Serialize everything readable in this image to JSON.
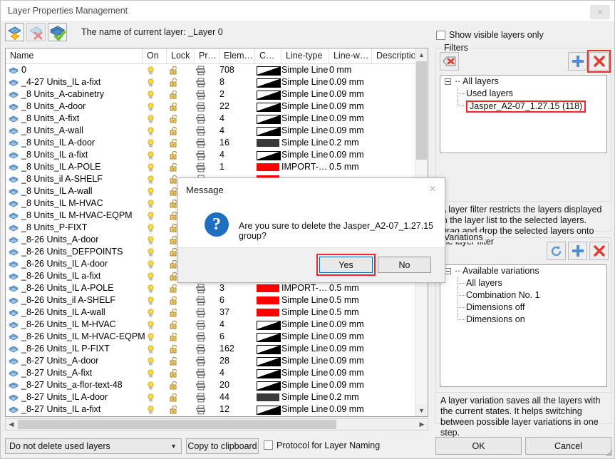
{
  "window": {
    "title": "Layer Properties Management",
    "close_icon": "close-icon"
  },
  "toolbar": {
    "buttons": [
      {
        "name": "new-layer-icon",
        "title": "New layer"
      },
      {
        "name": "delete-layer-icon",
        "title": "Delete layer"
      },
      {
        "name": "set-current-layer-icon",
        "title": "Set current layer"
      }
    ],
    "current_layer_text": "The name of current layer:  _Layer 0"
  },
  "layer_table": {
    "columns": [
      "Name",
      "On",
      "Lock",
      "Pr…",
      "Elem…",
      "C…",
      "Line-type",
      "Line-w…",
      "Description"
    ],
    "rows": [
      {
        "name": "0",
        "elem": "708",
        "color": "gradient",
        "linetype": "Simple Line",
        "linew": "0 mm"
      },
      {
        "name": "_4-27 Units_IL a-fixt",
        "elem": "8",
        "color": "gradient",
        "linetype": "Simple Line",
        "linew": "0.09 mm"
      },
      {
        "name": "_8 Units_A-cabinetry",
        "elem": "2",
        "color": "gradient",
        "linetype": "Simple Line",
        "linew": "0.09 mm"
      },
      {
        "name": "_8 Units_A-door",
        "elem": "22",
        "color": "gradient",
        "linetype": "Simple Line",
        "linew": "0.09 mm"
      },
      {
        "name": "_8 Units_A-fixt",
        "elem": "4",
        "color": "gradient",
        "linetype": "Simple Line",
        "linew": "0.09 mm"
      },
      {
        "name": "_8 Units_A-wall",
        "elem": "4",
        "color": "gradient",
        "linetype": "Simple Line",
        "linew": "0.09 mm"
      },
      {
        "name": "_8 Units_IL A-door",
        "elem": "16",
        "color": "dark",
        "linetype": "Simple Line",
        "linew": "0.2 mm"
      },
      {
        "name": "_8 Units_IL a-fixt",
        "elem": "4",
        "color": "gradient",
        "linetype": "Simple Line",
        "linew": "0.09 mm"
      },
      {
        "name": "_8 Units_IL A-POLE",
        "elem": "1",
        "color": "red",
        "linetype": "IMPORT-…",
        "linew": "0.5 mm"
      },
      {
        "name": "_8 Units_il A-SHELF",
        "elem": "",
        "color": "red",
        "linetype": "",
        "linew": ""
      },
      {
        "name": "_8 Units_IL A-wall",
        "elem": "",
        "color": "",
        "linetype": "",
        "linew": ""
      },
      {
        "name": "_8 Units_IL M-HVAC",
        "elem": "",
        "color": "",
        "linetype": "",
        "linew": ""
      },
      {
        "name": "_8 Units_IL M-HVAC-EQPM",
        "elem": "",
        "color": "",
        "linetype": "",
        "linew": ""
      },
      {
        "name": "_8 Units_P-FIXT",
        "elem": "",
        "color": "",
        "linetype": "",
        "linew": ""
      },
      {
        "name": "_8-26 Units_A-door",
        "elem": "",
        "color": "",
        "linetype": "",
        "linew": ""
      },
      {
        "name": "_8-26 Units_DEFPOINTS",
        "elem": "",
        "color": "",
        "linetype": "",
        "linew": ""
      },
      {
        "name": "_8-26 Units_IL A-door",
        "elem": "",
        "color": "",
        "linetype": "",
        "linew": ""
      },
      {
        "name": "_8-26 Units_IL a-fixt",
        "elem": "",
        "color": "",
        "linetype": "",
        "linew": ""
      },
      {
        "name": "_8-26 Units_IL A-POLE",
        "elem": "3",
        "color": "red",
        "linetype": "IMPORT-…",
        "linew": "0.5 mm"
      },
      {
        "name": "_8-26 Units_il A-SHELF",
        "elem": "6",
        "color": "red",
        "linetype": "Simple Line",
        "linew": "0.5 mm"
      },
      {
        "name": "_8-26 Units_IL A-wall",
        "elem": "37",
        "color": "red",
        "linetype": "Simple Line",
        "linew": "0.5 mm"
      },
      {
        "name": "_8-26 Units_IL M-HVAC",
        "elem": "4",
        "color": "gradient",
        "linetype": "Simple Line",
        "linew": "0.09 mm"
      },
      {
        "name": "_8-26 Units_IL M-HVAC-EQPM",
        "elem": "6",
        "color": "gradient",
        "linetype": "Simple Line",
        "linew": "0.09 mm"
      },
      {
        "name": "_8-26 Units_IL P-FIXT",
        "elem": "162",
        "color": "gradient",
        "linetype": "Simple Line",
        "linew": "0.09 mm"
      },
      {
        "name": "_8-27 Units_A-door",
        "elem": "28",
        "color": "gradient",
        "linetype": "Simple Line",
        "linew": "0.09 mm"
      },
      {
        "name": "_8-27 Units_A-fixt",
        "elem": "4",
        "color": "gradient",
        "linetype": "Simple Line",
        "linew": "0.09 mm"
      },
      {
        "name": "_8-27 Units_a-flor-text-48",
        "elem": "20",
        "color": "gradient",
        "linetype": "Simple Line",
        "linew": "0.09 mm"
      },
      {
        "name": "_8-27 Units_IL A-door",
        "elem": "44",
        "color": "dark",
        "linetype": "Simple Line",
        "linew": "0.2 mm"
      },
      {
        "name": "_8-27 Units_IL a-fixt",
        "elem": "12",
        "color": "gradient",
        "linetype": "Simple Line",
        "linew": "0.09 mm"
      }
    ]
  },
  "bottom_bar": {
    "delete_mode": "Do not delete used layers",
    "copy_button": "Copy to clipboard",
    "protocol_checkbox_label": "Protocol for Layer Naming",
    "protocol_checked": false
  },
  "right_panel": {
    "show_visible_only_label": "Show visible layers only",
    "show_visible_only_checked": false,
    "filters": {
      "legend": "Filters",
      "buttons": [
        {
          "name": "invert-filter-icon"
        },
        {
          "name": "add-filter-icon"
        },
        {
          "name": "delete-filter-icon",
          "highlighted": true
        }
      ],
      "tree": [
        {
          "label": "All layers",
          "level": 0,
          "expander": true
        },
        {
          "label": "Used layers",
          "level": 1
        },
        {
          "label": "Jasper_A2-07_1.27.15 (118)",
          "level": 1,
          "highlighted": true
        }
      ],
      "help": "A layer filter restricts the layers displayed in the layer list to the selected layers. Drag and drop the selected layers onto the layer filter"
    },
    "variations": {
      "legend": "Variations",
      "buttons": [
        {
          "name": "refresh-variation-icon"
        },
        {
          "name": "add-variation-icon"
        },
        {
          "name": "delete-variation-icon"
        }
      ],
      "tree": [
        {
          "label": "Available variations",
          "level": 0,
          "expander": true
        },
        {
          "label": "All layers",
          "level": 1
        },
        {
          "label": "Combination No. 1",
          "level": 1
        },
        {
          "label": "Dimensions off",
          "level": 1
        },
        {
          "label": "Dimensions on",
          "level": 1
        }
      ],
      "help": "A layer variation saves all the layers with the current states. It helps switching between possible layer variations in one step."
    },
    "ok_button": "OK",
    "cancel_button": "Cancel"
  },
  "message_dialog": {
    "title": "Message",
    "text": "Are you sure to delete the Jasper_A2-07_1.27.15 group?",
    "icon": "question-icon",
    "yes_button": "Yes",
    "no_button": "No",
    "close_icon": "close-icon"
  },
  "colors": {
    "accent_red": "#ec2b26",
    "focus_blue": "#0a68b1",
    "icon_blue": "#1e6fc0",
    "layer_red": "#ff0000",
    "layer_dark": "#3a3a3a"
  }
}
